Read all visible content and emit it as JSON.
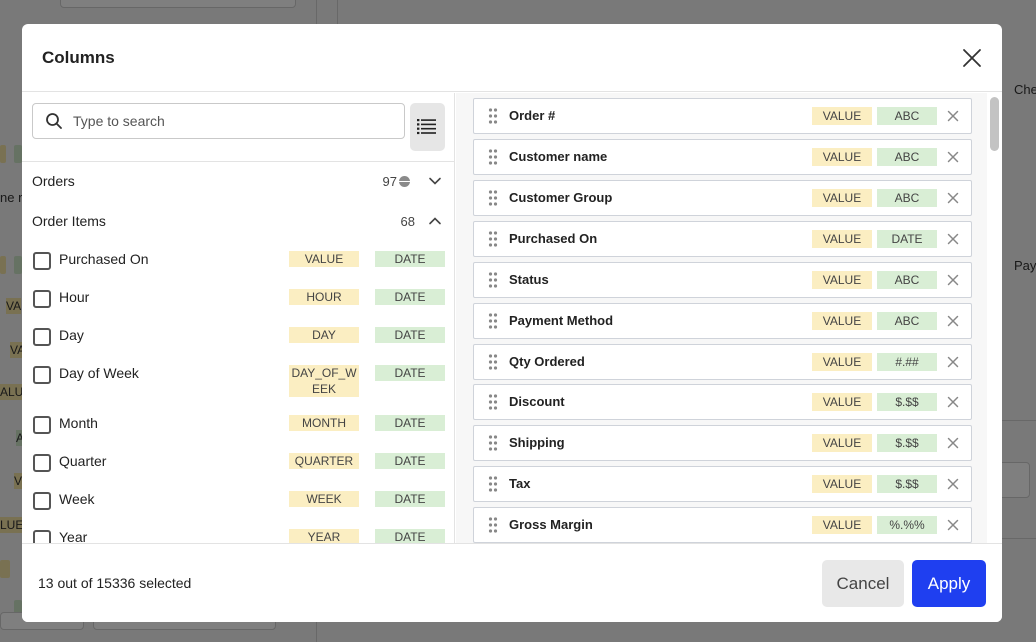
{
  "background": {
    "fragments": [
      "ne re",
      "VA",
      "VA",
      "ALU",
      "A",
      "V",
      "LUE",
      "V",
      "Che",
      "Pay"
    ]
  },
  "modal": {
    "title": "Columns",
    "close_icon": "close-icon"
  },
  "search": {
    "placeholder": "Type to search",
    "icon": "search-icon"
  },
  "list_view_icon": "list-icon",
  "groups": [
    {
      "label": "Orders",
      "count": "97",
      "state": "collapsed"
    },
    {
      "label": "Order Items",
      "count": "68",
      "state": "expanded"
    }
  ],
  "items": [
    {
      "label": "Purchased On",
      "value_tag": "VALUE",
      "type_tag": "DATE"
    },
    {
      "label": "Hour",
      "value_tag": "HOUR",
      "type_tag": "DATE"
    },
    {
      "label": "Day",
      "value_tag": "DAY",
      "type_tag": "DATE"
    },
    {
      "label": "Day of Week",
      "value_tag": "DAY_OF_WEEK",
      "type_tag": "DATE"
    },
    {
      "label": "Month",
      "value_tag": "MONTH",
      "type_tag": "DATE"
    },
    {
      "label": "Quarter",
      "value_tag": "QUARTER",
      "type_tag": "DATE"
    },
    {
      "label": "Week",
      "value_tag": "WEEK",
      "type_tag": "DATE"
    },
    {
      "label": "Year",
      "value_tag": "YEAR",
      "type_tag": "DATE"
    }
  ],
  "selected_columns": [
    {
      "label": "Order #",
      "value_tag": "VALUE",
      "type_tag": "ABC"
    },
    {
      "label": "Customer name",
      "value_tag": "VALUE",
      "type_tag": "ABC"
    },
    {
      "label": "Customer Group",
      "value_tag": "VALUE",
      "type_tag": "ABC"
    },
    {
      "label": "Purchased On",
      "value_tag": "VALUE",
      "type_tag": "DATE"
    },
    {
      "label": "Status",
      "value_tag": "VALUE",
      "type_tag": "ABC"
    },
    {
      "label": "Payment Method",
      "value_tag": "VALUE",
      "type_tag": "ABC"
    },
    {
      "label": "Qty Ordered",
      "value_tag": "VALUE",
      "type_tag": "#.##"
    },
    {
      "label": "Discount",
      "value_tag": "VALUE",
      "type_tag": "$.$$"
    },
    {
      "label": "Shipping",
      "value_tag": "VALUE",
      "type_tag": "$.$$"
    },
    {
      "label": "Tax",
      "value_tag": "VALUE",
      "type_tag": "$.$$"
    },
    {
      "label": "Gross Margin",
      "value_tag": "VALUE",
      "type_tag": "%.%%"
    }
  ],
  "footer": {
    "selection_text": "13 out of 15336 selected",
    "cancel_label": "Cancel",
    "apply_label": "Apply"
  },
  "colors": {
    "accent": "#1f3ff0",
    "value_tag": "#fbeec2",
    "type_tag": "#d9eed5"
  }
}
